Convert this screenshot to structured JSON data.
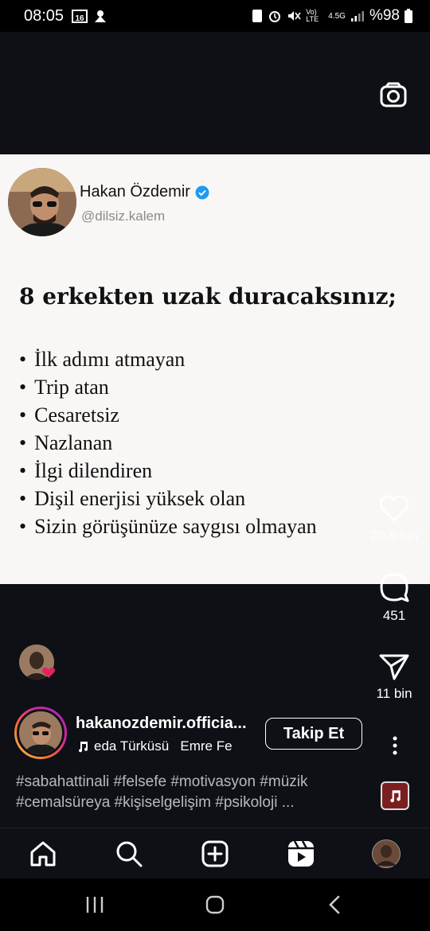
{
  "status_bar": {
    "time": "08:05",
    "network": "4.5G",
    "volte": "Vo) LTE",
    "battery": "%98"
  },
  "tweet": {
    "author_name": "Hakan Özdemir",
    "handle": "@dilsiz.kalem",
    "title": "8 erkekten uzak duracaksınız;",
    "items": [
      "İlk adımı atmayan",
      "Trip atan",
      "Cesaretsiz",
      "Nazlanan",
      "İlgi dilendiren",
      "Dişil enerjisi yüksek olan",
      "Sizin görüşünüze saygısı olmayan"
    ]
  },
  "actions": {
    "likes": "20,8 bin",
    "comments": "451",
    "shares": "11 bin"
  },
  "profile": {
    "username": "hakanozdemir.officia...",
    "music": "eda Türküsü   Emre Fe",
    "follow_label": "Takip Et"
  },
  "caption": {
    "hashtags": "#sabahattinali #felsefe #motivasyon #müzik #cemalsüreya #kişiselgelişim #psikoloji ..."
  },
  "colors": {
    "background": "#0e1015",
    "card": "#f9f7f6",
    "verified": "#1d9bf0",
    "heart": "#e0245e"
  }
}
